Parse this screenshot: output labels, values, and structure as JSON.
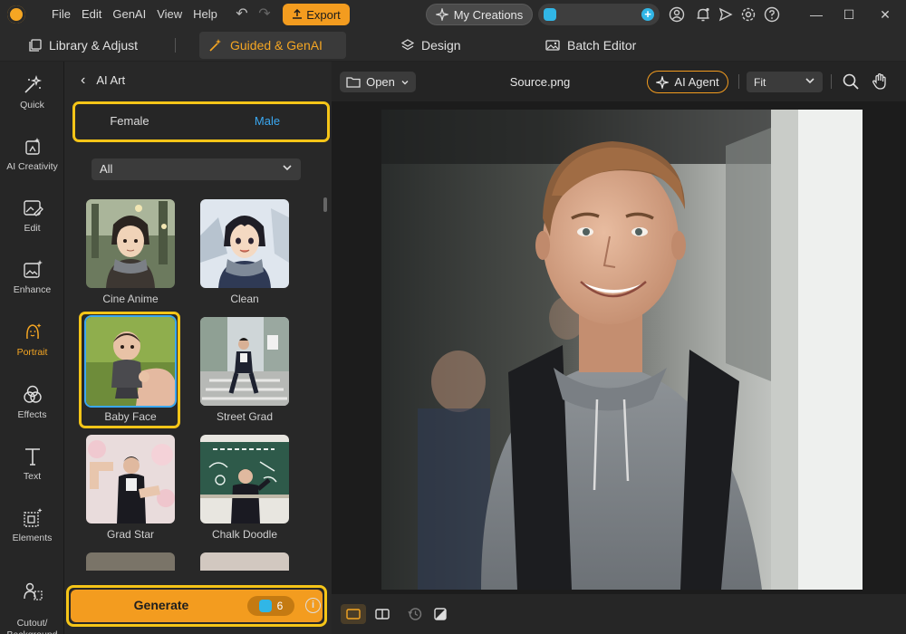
{
  "menu": {
    "file": "File",
    "edit": "Edit",
    "genai": "GenAI",
    "view": "View",
    "help": "Help"
  },
  "titlebar": {
    "export_label": "Export",
    "my_creations_label": "My Creations"
  },
  "modes": {
    "library": "Library & Adjust",
    "guided": "Guided & GenAI",
    "design": "Design",
    "batch": "Batch Editor"
  },
  "tools": [
    {
      "label": "Quick"
    },
    {
      "label": "AI Creativity"
    },
    {
      "label": "Edit"
    },
    {
      "label": "Enhance"
    },
    {
      "label": "Portrait"
    },
    {
      "label": "Effects"
    },
    {
      "label": "Text"
    },
    {
      "label": "Elements"
    },
    {
      "label": "Cutout/\nBackground"
    }
  ],
  "panel": {
    "title": "AI Art",
    "gender": {
      "female": "Female",
      "male": "Male",
      "selected": "Male"
    },
    "filter": "All",
    "styles": [
      {
        "label": "Cine Anime"
      },
      {
        "label": "Clean"
      },
      {
        "label": "Baby Face",
        "selected": true
      },
      {
        "label": "Street Grad"
      },
      {
        "label": "Grad Star"
      },
      {
        "label": "Chalk Doodle"
      }
    ],
    "generate_label": "Generate",
    "credit_cost": "6"
  },
  "canvas": {
    "open_label": "Open",
    "filename": "Source.png",
    "ai_agent_label": "AI Agent",
    "zoom": "Fit"
  },
  "colors": {
    "accent_orange": "#f39c1f",
    "highlight_yellow": "#f5c518",
    "selected_blue": "#3aa7f0",
    "credit_cyan": "#31b6e6"
  }
}
